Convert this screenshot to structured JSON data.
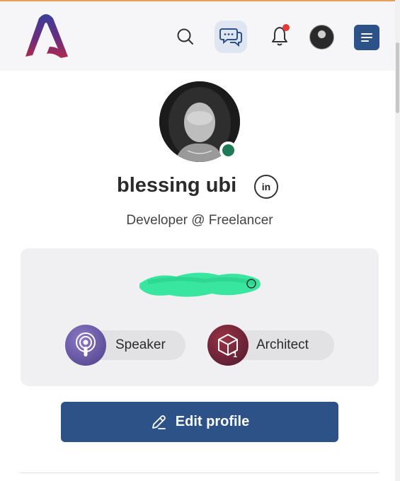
{
  "header": {
    "logo_icon": "brand-logo-icon",
    "search_icon": "search-icon",
    "chat_icon": "chat-bubbles-icon",
    "notification_icon": "bell-icon",
    "menu_icon": "menu-icon",
    "has_unread_notifications": true,
    "colors": {
      "accent": "#2d5288",
      "notification_dot": "#e53935"
    }
  },
  "profile": {
    "name": "blessing ubi",
    "linkedin_label": "in",
    "title": "Developer @ Freelancer",
    "online_status_color": "#1e7a55"
  },
  "badges": [
    {
      "label": "Speaker",
      "icon": "podcast-icon",
      "color": "#5e4f9f"
    },
    {
      "label": "Architect",
      "icon": "cube-icon",
      "color": "#6d2236",
      "count": "1"
    }
  ],
  "actions": {
    "edit_label": "Edit profile",
    "edit_icon": "pencil-icon"
  }
}
